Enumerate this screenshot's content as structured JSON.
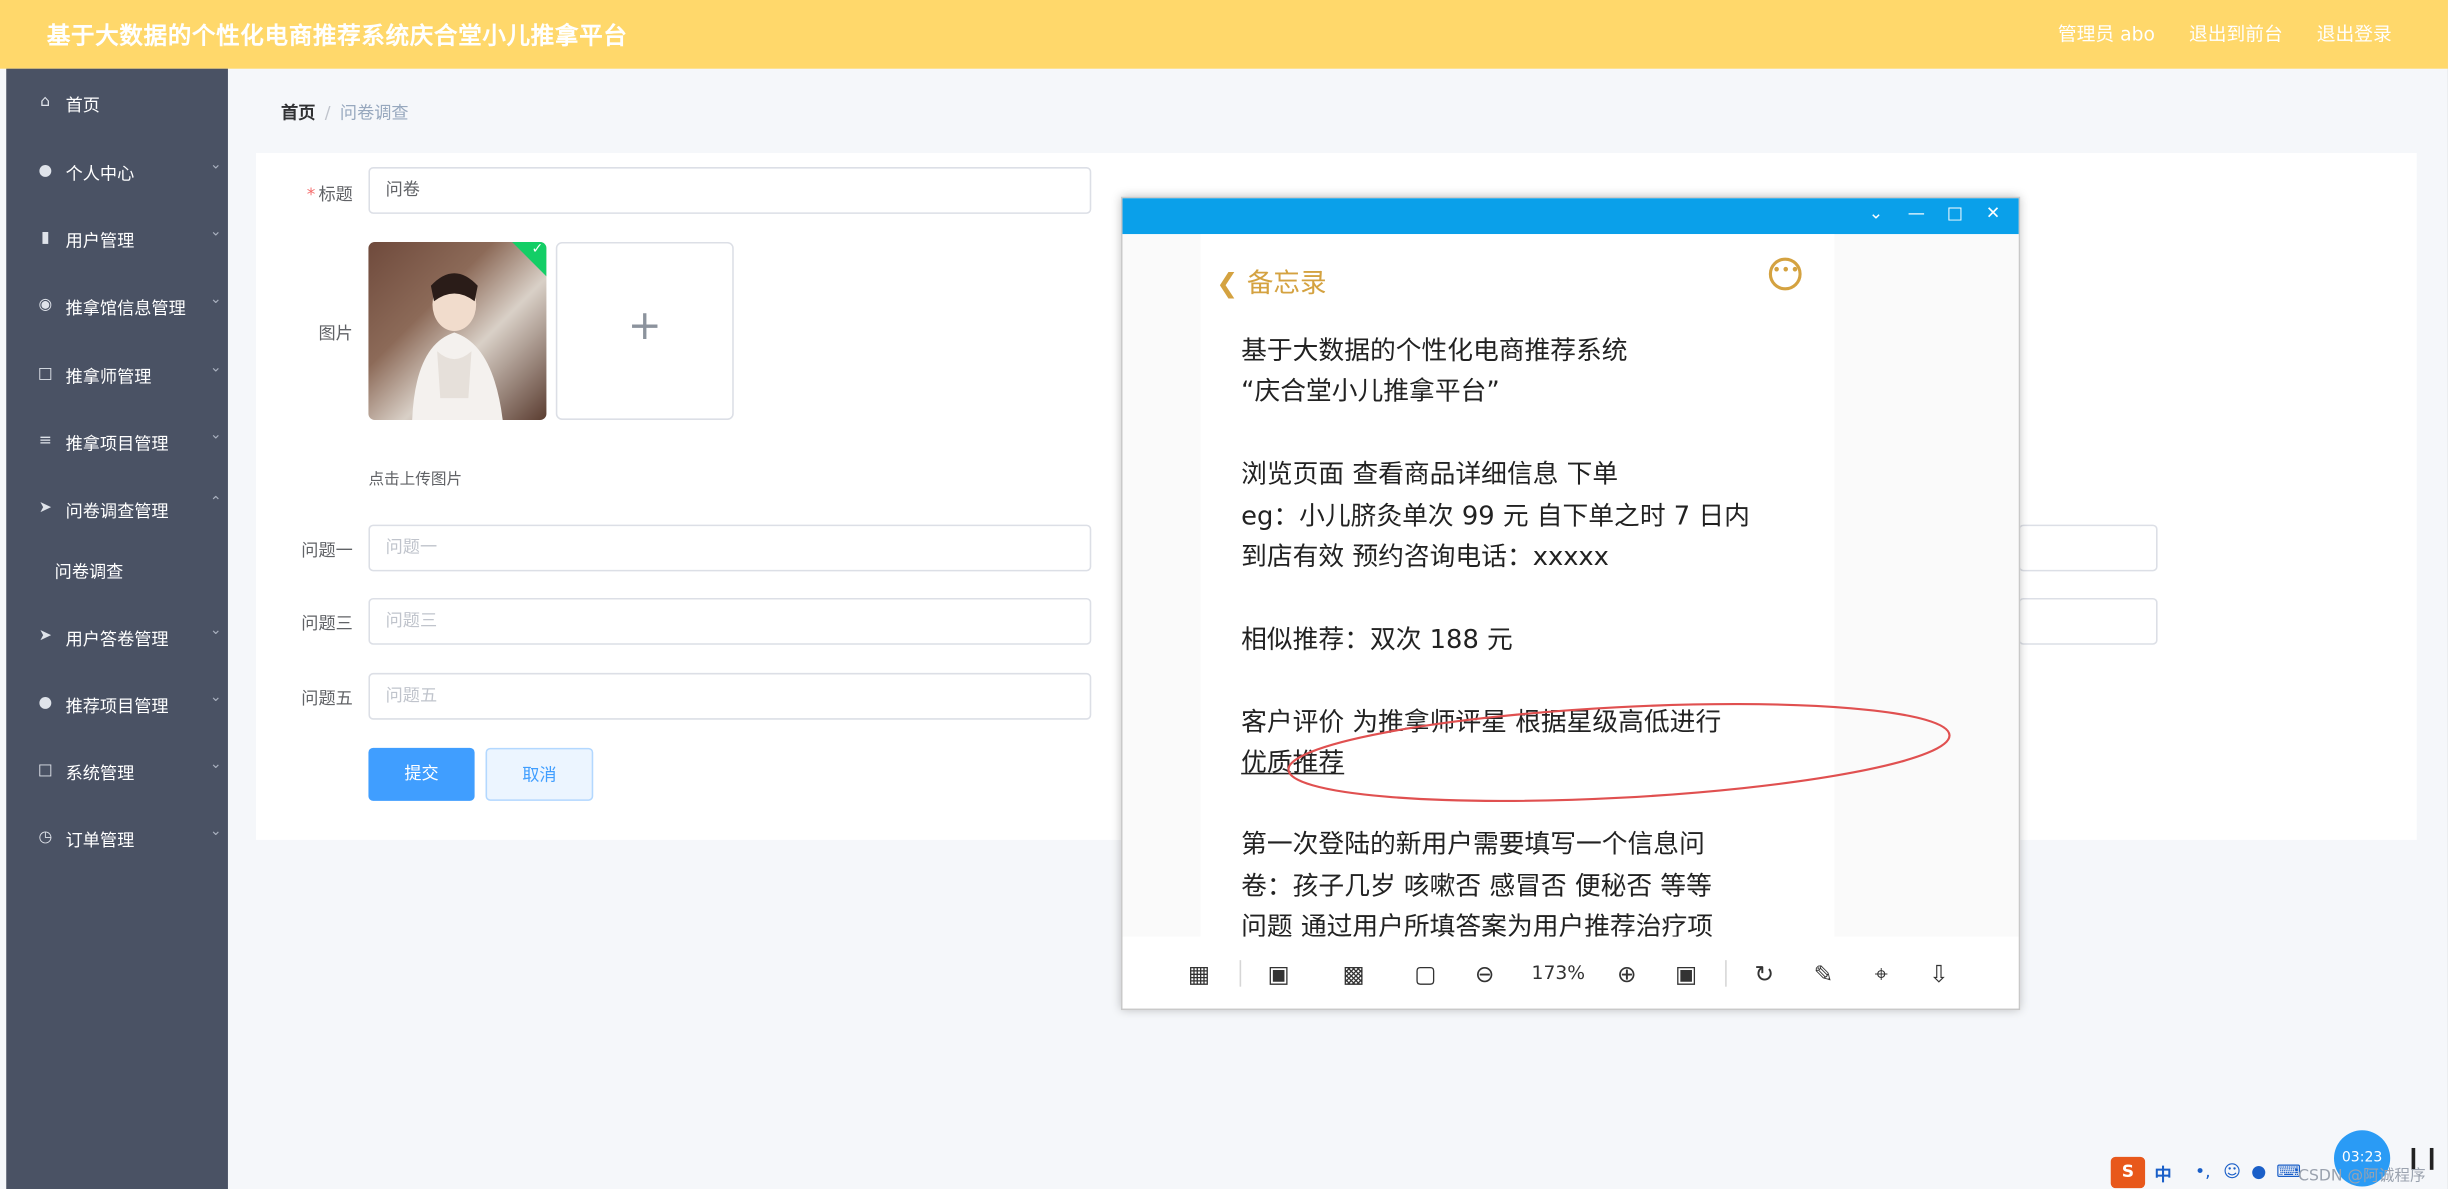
{
  "header": {
    "title": "基于大数据的个性化电商推荐系统庆合堂小儿推拿平台",
    "admin_label": "管理员 abo",
    "exit_frontend": "退出到前台",
    "logout": "退出登录"
  },
  "sidebar": {
    "items": [
      {
        "label": "首页",
        "icon": "home-icon"
      },
      {
        "label": "个人中心",
        "icon": "user-icon"
      },
      {
        "label": "用户管理",
        "icon": "bar-chart-icon"
      },
      {
        "label": "推拿馆信息管理",
        "icon": "microphone-icon"
      },
      {
        "label": "推拿师管理",
        "icon": "message-icon"
      },
      {
        "label": "推拿项目管理",
        "icon": "menu-icon"
      },
      {
        "label": "问卷调查管理",
        "icon": "send-icon"
      },
      {
        "label": "问卷调查",
        "icon": ""
      },
      {
        "label": "用户答卷管理",
        "icon": "paper-plane-icon"
      },
      {
        "label": "推荐项目管理",
        "icon": "location-icon"
      },
      {
        "label": "系统管理",
        "icon": "fullscreen-icon"
      },
      {
        "label": "订单管理",
        "icon": "clock-icon"
      }
    ]
  },
  "breadcrumb": {
    "home": "首页",
    "current": "问卷调查"
  },
  "form": {
    "title_label": "标题",
    "title_value": "问卷",
    "image_label": "图片",
    "upload_tip": "点击上传图片",
    "q1_label": "问题一",
    "q1_placeholder": "问题一",
    "q3_label": "问题三",
    "q3_placeholder": "问题三",
    "q5_label": "问题五",
    "q5_placeholder": "问题五",
    "submit": "提交",
    "cancel": "取消"
  },
  "viewer": {
    "memo_back": "备忘录",
    "lines": [
      "基于大数据的个性化电商推荐系统",
      "“庆合堂小儿推拿平台”",
      "浏览页面  查看商品详细信息  下单",
      "eg：小儿脐灸单次 99 元 自下单之时 7 日内",
      "到店有效 预约咨询电话：xxxxx",
      "相似推荐：双次 188 元",
      "客户评价 为推拿师评星 根据星级高低进行",
      "优质推荐",
      "第一次登陆的新用户需要填写一个信息问",
      "卷：孩子几岁 咳嗽否 感冒否 便秘否 等等",
      "问题 通过用户所填答案为用户推荐治疗项"
    ],
    "zoom": "173%"
  },
  "taskbar": {
    "ime": "中",
    "watermark": "CSDN @阿诚程序",
    "clock": "03:23"
  },
  "colors": {
    "header_bg": "#ffd86b",
    "sidebar_bg": "#4a5264",
    "primary": "#409eff",
    "viewer_title_bar": "#0aa0ea",
    "memo_accent": "#d4a240",
    "annotation_ellipse": "#e05050"
  }
}
